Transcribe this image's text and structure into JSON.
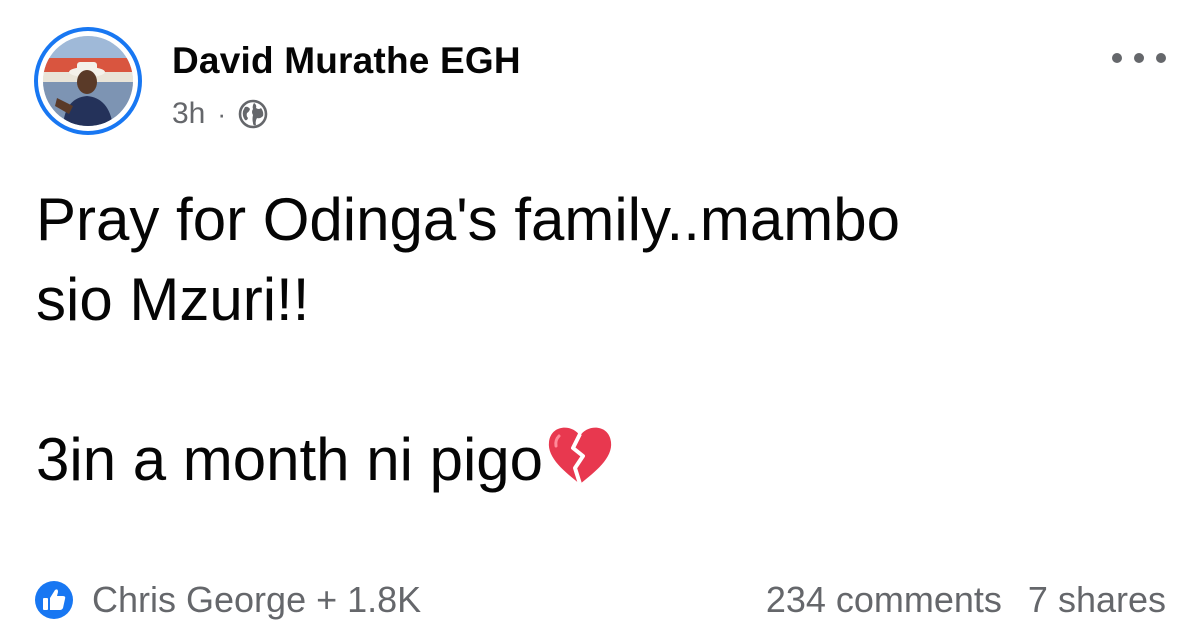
{
  "post": {
    "author": {
      "name": "David Murathe EGH"
    },
    "meta": {
      "time": "3h",
      "separator": "·",
      "audience_icon": "globe-icon"
    },
    "more_icon": "more-horizontal-icon",
    "text": {
      "line1": "Pray for Odinga's family..mambo",
      "line2": "sio Mzuri!!",
      "line3": "3in a month ni pigo",
      "emoji": "broken-heart-icon"
    },
    "reactions": {
      "icon": "like-badge-icon",
      "summary": "Chris George + 1.8K",
      "comments": "234 comments",
      "shares": "7 shares"
    },
    "colors": {
      "accent": "#1877f2",
      "text": "#050505",
      "secondary": "#65676b",
      "heart": "#e8384f"
    }
  }
}
